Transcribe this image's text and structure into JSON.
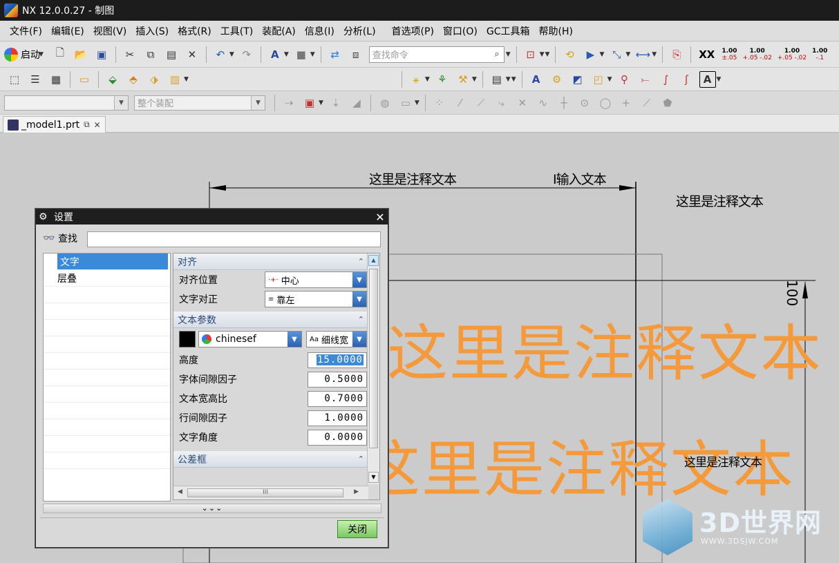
{
  "window": {
    "title": "NX 12.0.0.27 - 制图"
  },
  "menu": {
    "items": [
      "文件(F)",
      "编辑(E)",
      "视图(V)",
      "插入(S)",
      "格式(R)",
      "工具(T)",
      "装配(A)",
      "信息(I)",
      "分析(L)",
      "首选项(P)",
      "窗口(O)",
      "GC工具箱",
      "帮助(H)"
    ]
  },
  "toolbar": {
    "start_label": "启动",
    "search_placeholder": "查找命令",
    "xx_label": "XX",
    "tolerances": [
      {
        "top": "1.00",
        "bottom": "±.05"
      },
      {
        "top": "1.00",
        "bottom": "+.05 -.02"
      },
      {
        "top": "1.00",
        "bottom": "+.05 -.02"
      },
      {
        "top": "1.00",
        "bottom": "-.1"
      }
    ],
    "filter_combo_value": "",
    "assembly_combo_value": "整个装配"
  },
  "tab": {
    "label": "_model1.prt"
  },
  "canvas": {
    "annotations": {
      "top_center": "这里是注释文本",
      "input_text": "I输入文本",
      "top_right": "这里是注释文本",
      "big_1": "这里是注释文本",
      "big_2": "这里是注释文本",
      "right_mid": "这里是注释文本",
      "dim_vertical": "100"
    },
    "watermark": {
      "brand": "3D世界网",
      "url": "WWW.3DSJW.COM"
    }
  },
  "dialog": {
    "title": "设置",
    "find_label": "查找",
    "find_value": "",
    "tree": {
      "items": [
        "文字",
        "层叠"
      ],
      "selected": "文字"
    },
    "sections": {
      "align": {
        "header": "对齐",
        "position_label": "对齐位置",
        "position_value": "中心",
        "justify_label": "文字对正",
        "justify_value": "靠左"
      },
      "text_params": {
        "header": "文本参数",
        "color": "#000000",
        "font": "chinesef",
        "style": "细线宽",
        "style_prefix": "Aa",
        "rows": [
          {
            "label": "高度",
            "value": "15.0000"
          },
          {
            "label": "字体间隙因子",
            "value": "0.5000"
          },
          {
            "label": "文本宽高比",
            "value": "0.7000"
          },
          {
            "label": "行间隙因子",
            "value": "1.0000"
          },
          {
            "label": "文字角度",
            "value": "0.0000"
          }
        ]
      },
      "tolerance_frame": {
        "header": "公差框"
      }
    },
    "hscroll_grip": "III",
    "more_label": "⌄⌄⌄",
    "close_button": "关闭"
  },
  "colors": {
    "accent_select": "#3b89d9",
    "annotation_orange": "#f59a3a",
    "title_bar": "#1c1c1c",
    "close_button_green": "#78c860"
  }
}
